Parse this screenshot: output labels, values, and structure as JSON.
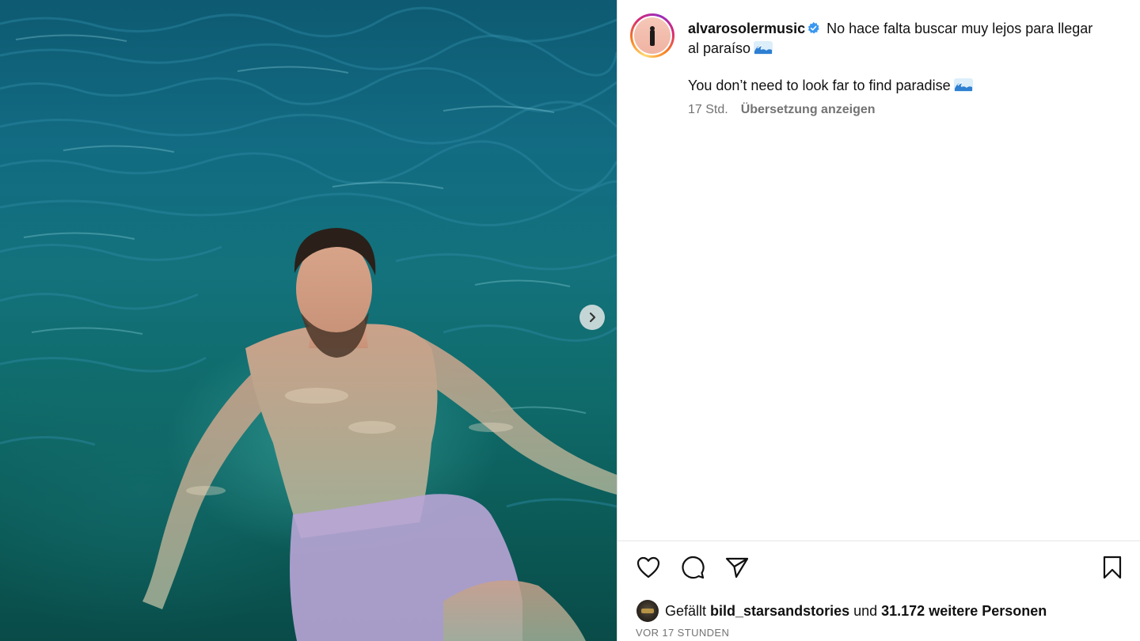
{
  "post": {
    "username": "alvarosolermusic",
    "caption_original": "No hace falta buscar muy lejos para llegar al paraíso",
    "caption_translated": "You don’t need to look far to find paradise",
    "time_ago": "17 Std.",
    "translate_label": "Übersetzung anzeigen",
    "timestamp": "VOR 17 STUNDEN"
  },
  "likes": {
    "prefix": "Gefällt",
    "liker": "bild_starsandstories",
    "conjunction": "und",
    "others": "31.172 weitere Personen"
  },
  "icons": {
    "verified": "verified-badge-icon",
    "wave": "water-wave-emoji-icon",
    "like": "heart-icon",
    "comment": "comment-bubble-icon",
    "share": "paper-plane-icon",
    "save": "bookmark-icon",
    "next": "chevron-right-icon"
  },
  "colors": {
    "verified_blue": "#3897f0",
    "meta_gray": "#737373",
    "water_teal": "#126b82"
  }
}
